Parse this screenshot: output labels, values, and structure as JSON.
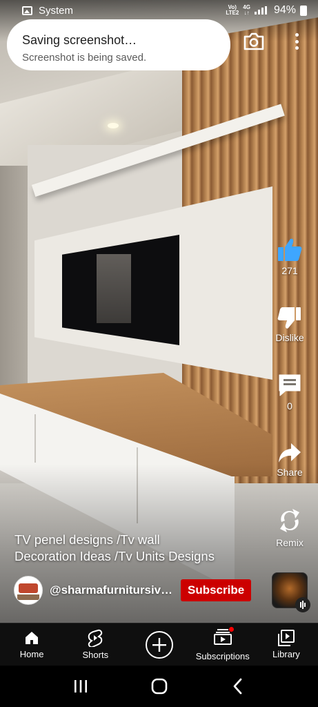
{
  "status_bar": {
    "app_label": "System",
    "network_top": "Vo)",
    "network_bottom": "LTE2",
    "data_type": "4G",
    "battery": "94%"
  },
  "toast": {
    "title": "Saving screenshot…",
    "subtitle": "Screenshot is being saved."
  },
  "actions": {
    "like_count": "271",
    "dislike_label": "Dislike",
    "comments_count": "0",
    "share_label": "Share",
    "remix_label": "Remix"
  },
  "video": {
    "title_line1": "TV penel designs /Tv wall",
    "title_line2": "Decoration Ideas /Tv Units Designs",
    "channel_name": "@sharmafurnitursiv…",
    "subscribe_label": "Subscribe"
  },
  "bottom_nav": {
    "home": "Home",
    "shorts": "Shorts",
    "subscriptions": "Subscriptions",
    "library": "Library"
  },
  "colors": {
    "like_blue": "#3ea6ff",
    "subscribe_red": "#cc0000",
    "notification_dot": "#ff0000"
  }
}
